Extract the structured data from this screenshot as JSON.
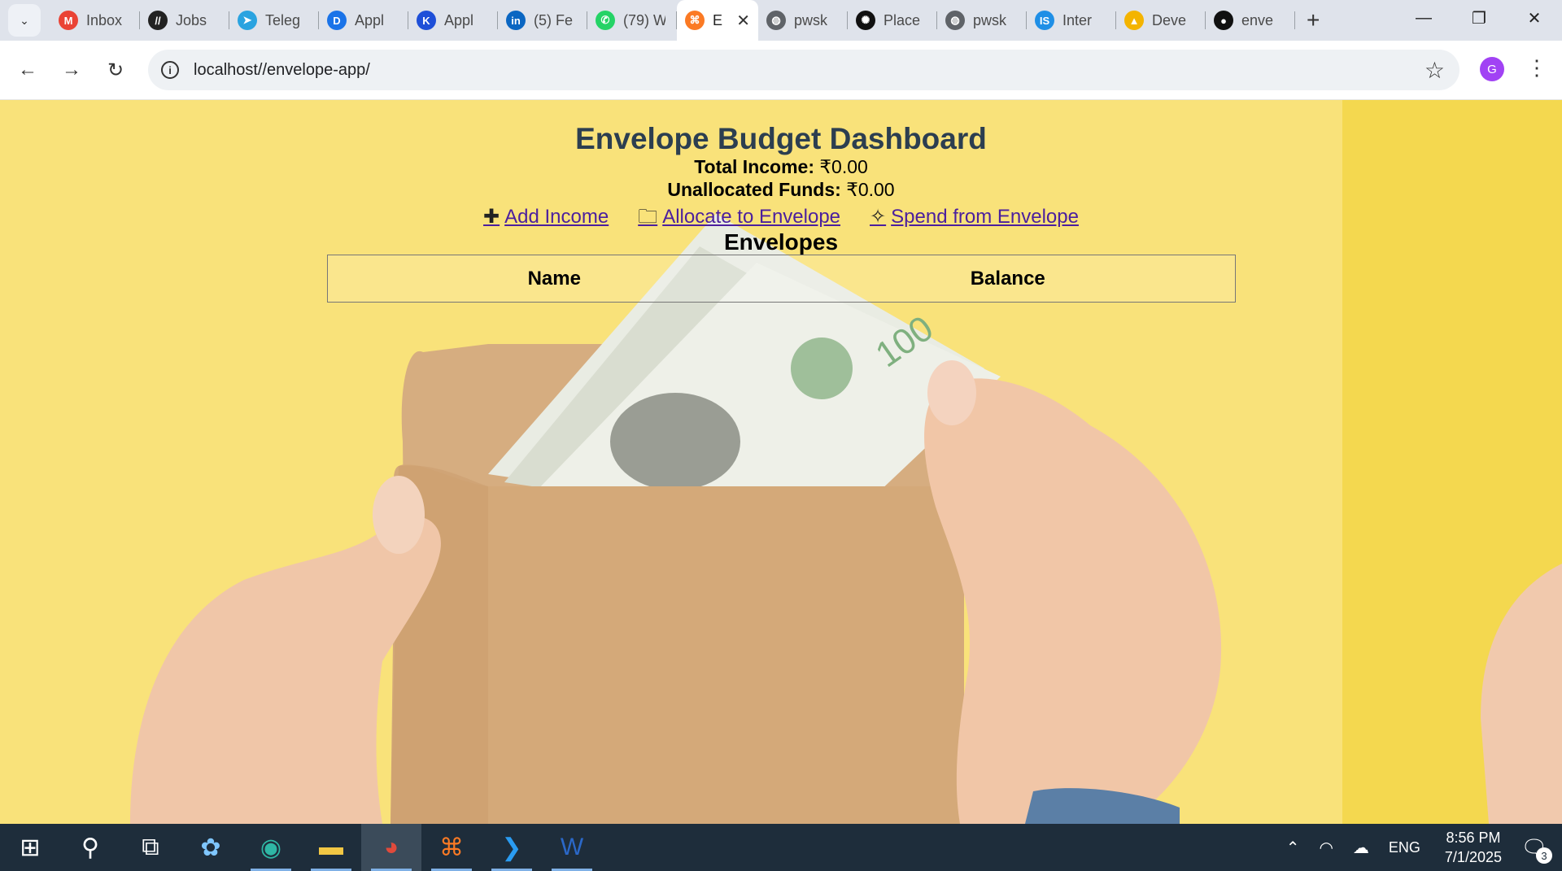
{
  "browser": {
    "tabs": [
      {
        "title": "Inbox",
        "icon": "gmail-icon",
        "color": "#ea4335",
        "glyph": "M"
      },
      {
        "title": "Jobs",
        "icon": "jobs-icon",
        "color": "#222222",
        "glyph": "//"
      },
      {
        "title": "Teleg",
        "icon": "telegram-icon",
        "color": "#2aa3e0",
        "glyph": "➤"
      },
      {
        "title": "Appl",
        "icon": "app-icon",
        "color": "#1a73e8",
        "glyph": "D"
      },
      {
        "title": "Appl",
        "icon": "app-icon",
        "color": "#1e4fd8",
        "glyph": "K"
      },
      {
        "title": "(5) Fe",
        "icon": "linkedin-icon",
        "color": "#0a66c2",
        "glyph": "in"
      },
      {
        "title": "(79) W",
        "icon": "whatsapp-icon",
        "color": "#25d366",
        "glyph": "✆"
      },
      {
        "title": "E",
        "icon": "xampp-icon",
        "color": "#fb7a24",
        "glyph": "⌘",
        "active": true
      },
      {
        "title": "pwsk",
        "icon": "globe-icon",
        "color": "#5f6368",
        "glyph": "◍"
      },
      {
        "title": "Place",
        "icon": "openai-icon",
        "color": "#111111",
        "glyph": "✺"
      },
      {
        "title": "pwsk",
        "icon": "globe-icon",
        "color": "#5f6368",
        "glyph": "◍"
      },
      {
        "title": "Inter",
        "icon": "is-icon",
        "color": "#1f8fe6",
        "glyph": "IS"
      },
      {
        "title": "Deve",
        "icon": "drive-icon",
        "color": "#f4b400",
        "glyph": "▲"
      },
      {
        "title": "enve",
        "icon": "github-icon",
        "color": "#111111",
        "glyph": "●"
      }
    ],
    "url": "localhost//envelope-app/",
    "profile_initial": "G"
  },
  "page": {
    "title": "Envelope Budget Dashboard",
    "total_income_label": "Total Income:",
    "total_income_value": "₹0.00",
    "unallocated_label": "Unallocated Funds:",
    "unallocated_value": "₹0.00",
    "actions": {
      "add_income": "Add Income",
      "allocate": "Allocate to Envelope",
      "spend": "Spend from Envelope"
    },
    "envelopes_heading": "Envelopes",
    "table": {
      "columns": [
        "Name",
        "Balance"
      ]
    }
  },
  "taskbar": {
    "language": "ENG",
    "time": "8:56 PM",
    "date": "7/1/2025",
    "notification_count": "3"
  }
}
